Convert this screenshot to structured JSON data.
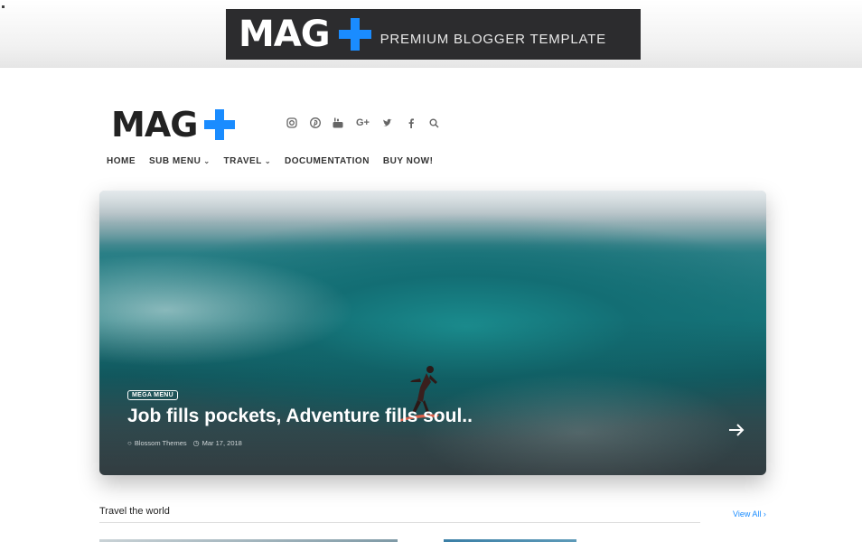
{
  "banner": {
    "logo_text": "MAG",
    "tagline": "PREMIUM BLOGGER TEMPLATE"
  },
  "site": {
    "logo_text": "MAG"
  },
  "social": [
    {
      "icon": "instagram-icon"
    },
    {
      "icon": "pinterest-icon"
    },
    {
      "icon": "youtube-icon"
    },
    {
      "icon": "google-plus-icon"
    },
    {
      "icon": "twitter-icon"
    },
    {
      "icon": "facebook-icon"
    },
    {
      "icon": "search-icon"
    }
  ],
  "nav": {
    "items": [
      {
        "label": "HOME"
      },
      {
        "label": "SUB MENU"
      },
      {
        "label": "TRAVEL"
      },
      {
        "label": "DOCUMENTATION"
      },
      {
        "label": "BUY NOW!"
      }
    ]
  },
  "hero": {
    "badge": "MEGA MENU",
    "title": "Job fills pockets, Adventure fills soul..",
    "author": "Blossom Themes",
    "date": "Mar 17, 2018"
  },
  "section": {
    "title": "Travel the world",
    "view_all": "View All"
  },
  "colors": {
    "accent": "#1a8cff",
    "banner_bg": "#2c2c2e"
  }
}
